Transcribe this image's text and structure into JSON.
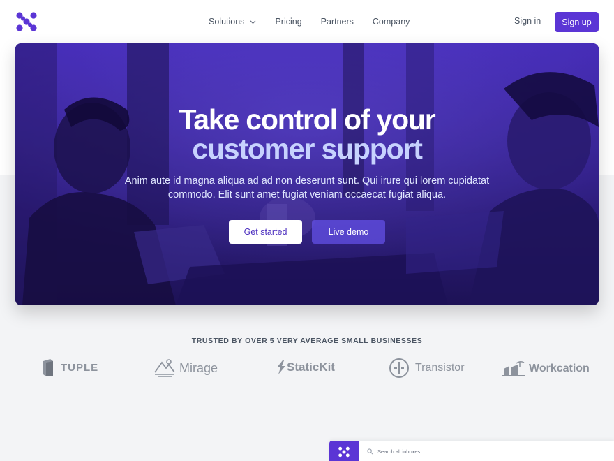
{
  "header": {
    "nav": [
      {
        "label": "Solutions",
        "has_dropdown": true
      },
      {
        "label": "Pricing"
      },
      {
        "label": "Partners"
      },
      {
        "label": "Company"
      }
    ],
    "signin_label": "Sign in",
    "signup_label": "Sign up"
  },
  "hero": {
    "title_line1": "Take control of your",
    "title_line2": "customer support",
    "subtitle": "Anim aute id magna aliqua ad ad non deserunt sunt. Qui irure qui lorem cupidatat commodo. Elit sunt amet fugiat veniam occaecat fugiat aliqua.",
    "primary_cta": "Get started",
    "secondary_cta": "Live demo"
  },
  "trusted": {
    "heading": "TRUSTED BY OVER 5 VERY AVERAGE SMALL BUSINESSES",
    "logos": [
      {
        "name": "TUPLE",
        "icon": "tuple-icon"
      },
      {
        "name": "Mirage",
        "icon": "mirage-icon"
      },
      {
        "name": "StaticKit",
        "icon": "statickit-icon"
      },
      {
        "name": "Transistor",
        "icon": "transistor-icon"
      },
      {
        "name": "Workcation",
        "icon": "workcation-icon"
      }
    ]
  },
  "preview": {
    "search_placeholder": "Search all inboxes"
  },
  "colors": {
    "brand": "#5b35d5",
    "hero_overlay": "#3b1fa3",
    "hero_title_accent": "#c7d2fe"
  }
}
